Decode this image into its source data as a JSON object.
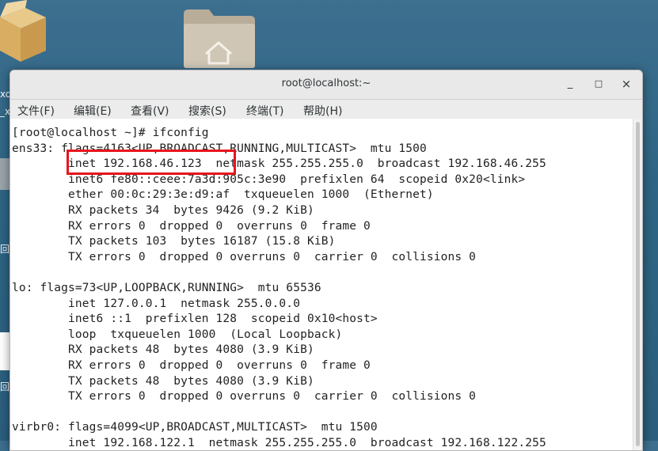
{
  "desktop": {
    "icon_box": "package-box-icon",
    "icon_folder": "home-folder-icon",
    "side_labels": [
      "xo",
      "_x",
      "回",
      "回"
    ]
  },
  "window": {
    "title": "root@localhost:~",
    "controls": {
      "minimize": "_",
      "maximize": "□",
      "close": "×"
    }
  },
  "menu": {
    "file": "文件(F)",
    "edit": "编辑(E)",
    "view": "查看(V)",
    "search": "搜索(S)",
    "terminal": "终端(T)",
    "help": "帮助(H)"
  },
  "terminal": {
    "lines": [
      "[root@localhost ~]# ifconfig",
      "ens33: flags=4163<UP,BROADCAST,RUNNING,MULTICAST>  mtu 1500",
      "        inet 192.168.46.123  netmask 255.255.255.0  broadcast 192.168.46.255",
      "        inet6 fe80::ceee:7a3d:905c:3e90  prefixlen 64  scopeid 0x20<link>",
      "        ether 00:0c:29:3e:d9:af  txqueuelen 1000  (Ethernet)",
      "        RX packets 34  bytes 9426 (9.2 KiB)",
      "        RX errors 0  dropped 0  overruns 0  frame 0",
      "        TX packets 103  bytes 16187 (15.8 KiB)",
      "        TX errors 0  dropped 0 overruns 0  carrier 0  collisions 0",
      "",
      "lo: flags=73<UP,LOOPBACK,RUNNING>  mtu 65536",
      "        inet 127.0.0.1  netmask 255.0.0.0",
      "        inet6 ::1  prefixlen 128  scopeid 0x10<host>",
      "        loop  txqueuelen 1000  (Local Loopback)",
      "        RX packets 48  bytes 4080 (3.9 KiB)",
      "        RX errors 0  dropped 0  overruns 0  frame 0",
      "        TX packets 48  bytes 4080 (3.9 KiB)",
      "        TX errors 0  dropped 0 overruns 0  carrier 0  collisions 0",
      "",
      "virbr0: flags=4099<UP,BROADCAST,MULTICAST>  mtu 1500",
      "        inet 192.168.122.1  netmask 255.255.255.0  broadcast 192.168.122.255"
    ]
  },
  "annotation": {
    "color": "#e8141c",
    "target": "inet 192.168.46.123"
  }
}
